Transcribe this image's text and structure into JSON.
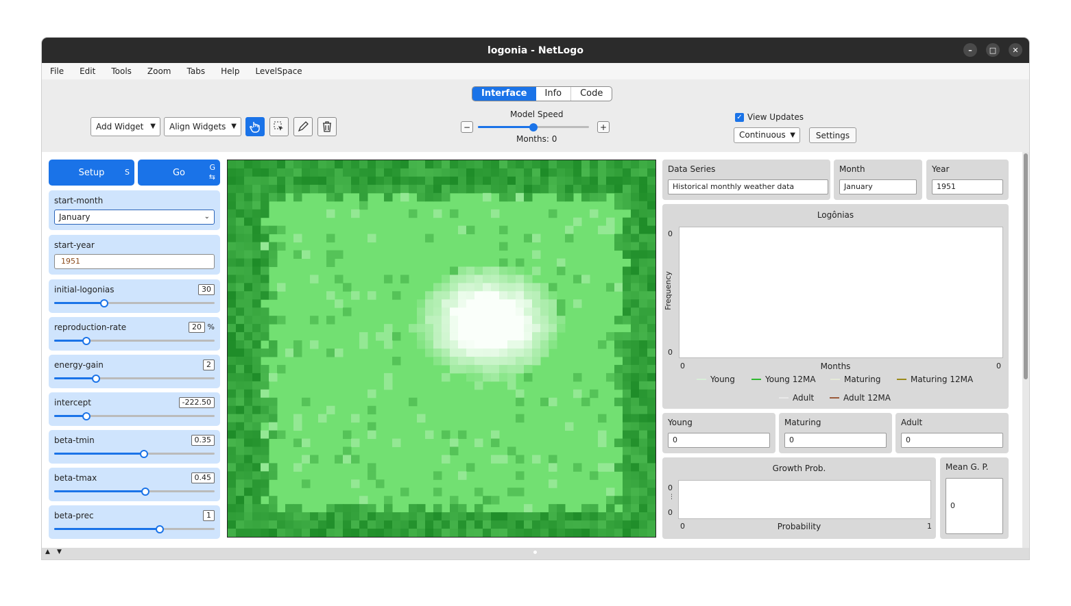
{
  "window": {
    "title": "logonia - NetLogo"
  },
  "menu": [
    "File",
    "Edit",
    "Tools",
    "Zoom",
    "Tabs",
    "Help",
    "LevelSpace"
  ],
  "tabs": [
    "Interface",
    "Info",
    "Code"
  ],
  "toolbar": {
    "add_widget": "Add Widget",
    "align_widgets": "Align Widgets",
    "model_speed_label": "Model Speed",
    "ticks_label": "Months: 0",
    "speed_minus": "−",
    "speed_plus": "+",
    "speed_level": 0.5,
    "view_updates_label": "View Updates",
    "view_updates_checked": true,
    "update_mode": "Continuous",
    "settings_label": "Settings"
  },
  "buttons": {
    "setup": {
      "label": "Setup",
      "key": "S"
    },
    "go": {
      "label": "Go",
      "key": "G"
    }
  },
  "chooser": {
    "label": "start-month",
    "value": "January"
  },
  "inputbox": {
    "label": "start-year",
    "value": "1951"
  },
  "sliders": [
    {
      "label": "initial-logonias",
      "value": "30",
      "unit": "",
      "level": 0.31
    },
    {
      "label": "reproduction-rate",
      "value": "20",
      "unit": "%",
      "level": 0.2
    },
    {
      "label": "energy-gain",
      "value": "2",
      "unit": "",
      "level": 0.26
    },
    {
      "label": "intercept",
      "value": "-222.50",
      "unit": "",
      "level": 0.2
    },
    {
      "label": "beta-tmin",
      "value": "0.35",
      "unit": "",
      "level": 0.56
    },
    {
      "label": "beta-tmax",
      "value": "0.45",
      "unit": "",
      "level": 0.57
    },
    {
      "label": "beta-prec",
      "value": "1",
      "unit": "",
      "level": 0.66
    }
  ],
  "monitors": {
    "data_series": {
      "label": "Data Series",
      "value": "Historical monthly weather data"
    },
    "month": {
      "label": "Month",
      "value": "January"
    },
    "year": {
      "label": "Year",
      "value": "1951"
    },
    "young": {
      "label": "Young",
      "value": "0"
    },
    "maturing": {
      "label": "Maturing",
      "value": "0"
    },
    "adult": {
      "label": "Adult",
      "value": "0"
    },
    "mean_gp": {
      "label": "Mean G. P.",
      "value": "0"
    }
  },
  "plot1": {
    "title": "Logônias",
    "ylabel": "Frequency",
    "xlabel": "Months",
    "ymax": "0",
    "ymin": "0",
    "xmin": "0",
    "xmax": "0",
    "legend": [
      {
        "name": "Young",
        "color": "#d8efd8"
      },
      {
        "name": "Young 12MA",
        "color": "#2eb82e"
      },
      {
        "name": "Maturing",
        "color": "#e6ebd8"
      },
      {
        "name": "Maturing 12MA",
        "color": "#9a8a1a"
      },
      {
        "name": "Adult",
        "color": "#e9e9e9"
      },
      {
        "name": "Adult 12MA",
        "color": "#9a5a3a"
      }
    ]
  },
  "plot2": {
    "title": "Growth Prob.",
    "xlabel": "Probability",
    "ymax": "0",
    "ymid": "⋮",
    "ymin": "0",
    "xmin": "0",
    "xmax": "1"
  },
  "colors": {
    "accent": "#1a73e8",
    "widget_bg": "#cfe4fd",
    "monitor_bg": "#d9d9d9",
    "patch_light": "#72e072",
    "patch_dark": "#1e8c28",
    "patch_white": "#fafffa"
  }
}
